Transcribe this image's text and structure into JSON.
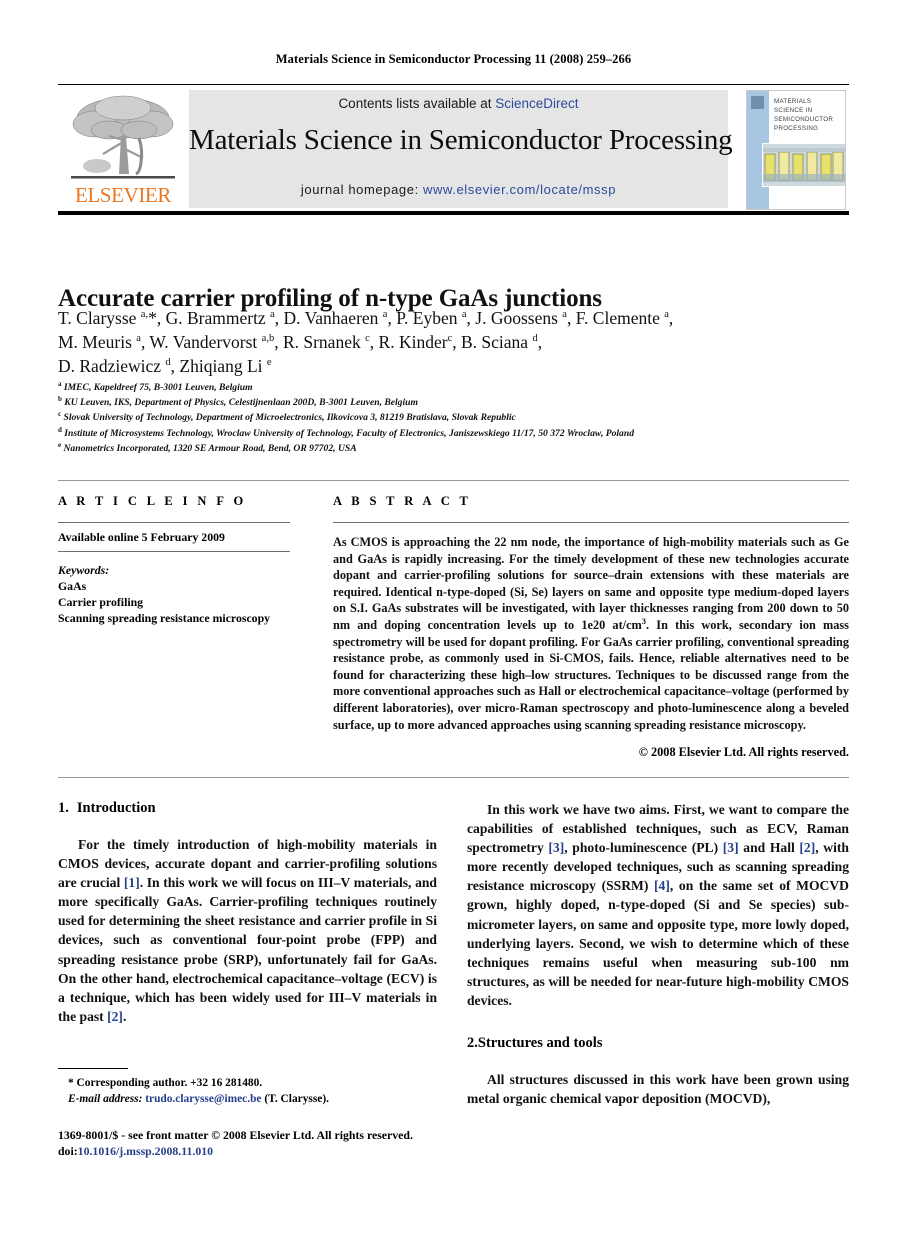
{
  "running_head": "Materials Science in Semiconductor Processing 11 (2008) 259–266",
  "masthead": {
    "publisher_name": "ELSEVIER",
    "contents_prefix": "Contents lists available at ",
    "contents_link": "ScienceDirect",
    "journal_title": "Materials Science in Semiconductor Processing",
    "homepage_prefix": "journal homepage: ",
    "homepage_url": "www.elsevier.com/locate/mssp",
    "cover_title": "MATERIALS SCIENCE IN SEMICONDUCTOR PROCESSING",
    "link_color": "#2b4a9b",
    "panel_color": "#e5e5e5",
    "cover_strip_color": "#a8c6e2"
  },
  "article": {
    "title": "Accurate carrier profiling of n-type GaAs junctions",
    "authors_line1": "T. Clarysse <sup>a,</sup>*, G. Brammertz <sup>a</sup>, D. Vanhaeren <sup>a</sup>, P. Eyben <sup>a</sup>, J. Goossens <sup>a</sup>, F. Clemente <sup>a</sup>,",
    "authors_line2": "M. Meuris <sup>a</sup>, W. Vandervorst <sup>a,b</sup>, R. Srnanek <sup>c</sup>, R. Kinder<sup>c</sup>, B. Sciana <sup>d</sup>,",
    "authors_line3": "D. Radziewicz <sup>d</sup>, Zhiqiang Li <sup>e</sup>",
    "affiliations": [
      "<sup>a</sup> IMEC, Kapeldreef 75, B-3001 Leuven, Belgium",
      "<sup>b</sup> KU Leuven, IKS, Department of Physics, Celestijnenlaan 200D, B-3001 Leuven, Belgium",
      "<sup>c</sup> Slovak University of Technology, Department of Microelectronics, Ilkovicova 3, 81219 Bratislava, Slovak Republic",
      "<sup>d</sup> Institute of Microsystems Technology, Wroclaw University of Technology, Faculty of Electronics, Janiszewskiego 11/17, 50 372 Wroclaw, Poland",
      "<sup>e</sup> Nanometrics Incorporated, 1320 SE Armour Road, Bend, OR 97702, USA"
    ]
  },
  "article_info": {
    "heading": "A R T I C L E  I N F O",
    "available_online": "Available online 5 February 2009",
    "keywords_heading": "Keywords:",
    "keywords": [
      "GaAs",
      "Carrier profiling",
      "Scanning spreading resistance microscopy"
    ]
  },
  "abstract": {
    "heading": "A B S T R A C T",
    "text": "As CMOS is approaching the 22 nm node, the importance of high-mobility materials such as Ge and GaAs is rapidly increasing. For the timely development of these new technologies accurate dopant and carrier-profiling solutions for source–drain extensions with these materials are required. Identical n-type-doped (Si, Se) layers on same and opposite type medium-doped layers on S.I. GaAs substrates will be investigated, with layer thicknesses ranging from 200 down to 50 nm and doping concentration levels up to 1e20 at/cm<sup>3</sup>. In this work, secondary ion mass spectrometry will be used for dopant profiling. For GaAs carrier profiling, conventional spreading resistance probe, as commonly used in Si-CMOS, fails. Hence, reliable alternatives need to be found for characterizing these high–low structures. Techniques to be discussed range from the more conventional approaches such as Hall or electrochemical capacitance–voltage (performed by different laboratories), over micro-Raman spectroscopy and photo-luminescence along a beveled surface, up to more advanced approaches using scanning spreading resistance microscopy.",
    "copyright": "© 2008 Elsevier Ltd. All rights reserved."
  },
  "body": {
    "section1_number": "1.",
    "section1_title": "Introduction",
    "section1_para": "For the timely introduction of high-mobility materials in CMOS devices, accurate dopant and carrier-profiling solutions are crucial <span class=\"ref\">[1]</span>. In this work we will focus on III–V materials, and more specifically GaAs. Carrier-profiling techniques routinely used for determining the sheet resistance and carrier profile in Si devices, such as conventional four-point probe (FPP) and spreading resistance probe (SRP), unfortunately fail for GaAs. On the other hand, electrochemical capacitance–voltage (ECV) is a technique, which has been widely used for III–V materials in the past <span class=\"ref\">[2]</span>.",
    "right_para": "In this work we have two aims. First, we want to compare the capabilities of established techniques, such as ECV, Raman spectrometry <span class=\"ref\">[3]</span>, photo-luminescence (PL) <span class=\"ref\">[3]</span> and Hall <span class=\"ref\">[2]</span>, with more recently developed techniques, such as scanning spreading resistance microscopy (SSRM) <span class=\"ref\">[4]</span>, on the same set of MOCVD grown, highly doped, n-type-doped (Si and Se species) sub-micrometer layers, on same and opposite type, more lowly doped, underlying layers. Second, we wish to determine which of these techniques remains useful when measuring sub-100 nm structures, as will be needed for near-future high-mobility CMOS devices.",
    "section2_number": "2.",
    "section2_title": "Structures and tools",
    "section2_para": "All structures discussed in this work have been grown using metal organic chemical vapor deposition (MOCVD),"
  },
  "footnotes": {
    "corresponding": "* Corresponding author. +32 16 281480.",
    "email_label": "E-mail address: ",
    "email": "trudo.clarysse@imec.be",
    "email_suffix": " (T. Clarysse).",
    "imprint_line": "1369-8001/$ - see front matter © 2008 Elsevier Ltd. All rights reserved.",
    "doi_label": "doi:",
    "doi": "10.1016/j.mssp.2008.11.010",
    "link_color": "#27408b"
  }
}
